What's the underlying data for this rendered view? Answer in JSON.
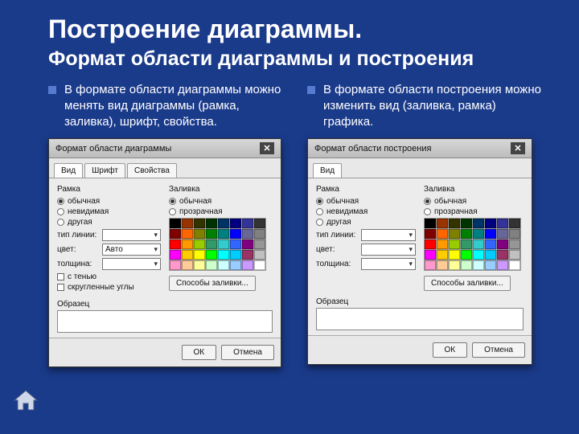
{
  "title": "Построение диаграммы.",
  "subtitle": "Формат области диаграммы и построения",
  "left_text": "В формате области диаграммы можно менять вид диаграммы (рамка, заливка), шрифт, свойства.",
  "right_text": "В формате области построения можно изменить вид (заливка, рамка) графика.",
  "dlg1": {
    "title": "Формат области диаграммы",
    "tabs": [
      "Вид",
      "Шрифт",
      "Свойства"
    ],
    "frame_group": "Рамка",
    "frame_options": [
      "обычная",
      "невидимая",
      "другая"
    ],
    "fill_group": "Заливка",
    "fill_options": [
      "обычная",
      "прозрачная"
    ],
    "f_type": "тип линии:",
    "f_color": "цвет:",
    "f_color_value": "Авто",
    "f_weight": "толщина:",
    "shadow": "с тенью",
    "rounded": "скругленные углы",
    "fill_button": "Способы заливки...",
    "sample_label": "Образец",
    "ok": "ОК",
    "cancel": "Отмена"
  },
  "dlg2": {
    "title": "Формат области построения",
    "tabs": [
      "Вид"
    ],
    "frame_group": "Рамка",
    "frame_options": [
      "обычная",
      "невидимая",
      "другая"
    ],
    "fill_group": "Заливка",
    "fill_options": [
      "обычная",
      "прозрачная"
    ],
    "f_type": "тип линии:",
    "f_color": "цвет:",
    "f_weight": "толщина:",
    "fill_button": "Способы заливки...",
    "sample_label": "Образец",
    "ok": "ОК",
    "cancel": "Отмена"
  },
  "palette": [
    "#000000",
    "#993300",
    "#333300",
    "#003300",
    "#003366",
    "#000080",
    "#333399",
    "#333333",
    "#800000",
    "#ff6600",
    "#808000",
    "#008000",
    "#008080",
    "#0000ff",
    "#666699",
    "#808080",
    "#ff0000",
    "#ff9900",
    "#99cc00",
    "#339966",
    "#33cccc",
    "#3366ff",
    "#800080",
    "#969696",
    "#ff00ff",
    "#ffcc00",
    "#ffff00",
    "#00ff00",
    "#00ffff",
    "#00ccff",
    "#993366",
    "#c0c0c0",
    "#ff99cc",
    "#ffcc99",
    "#ffff99",
    "#ccffcc",
    "#ccffff",
    "#99ccff",
    "#cc99ff",
    "#ffffff"
  ]
}
